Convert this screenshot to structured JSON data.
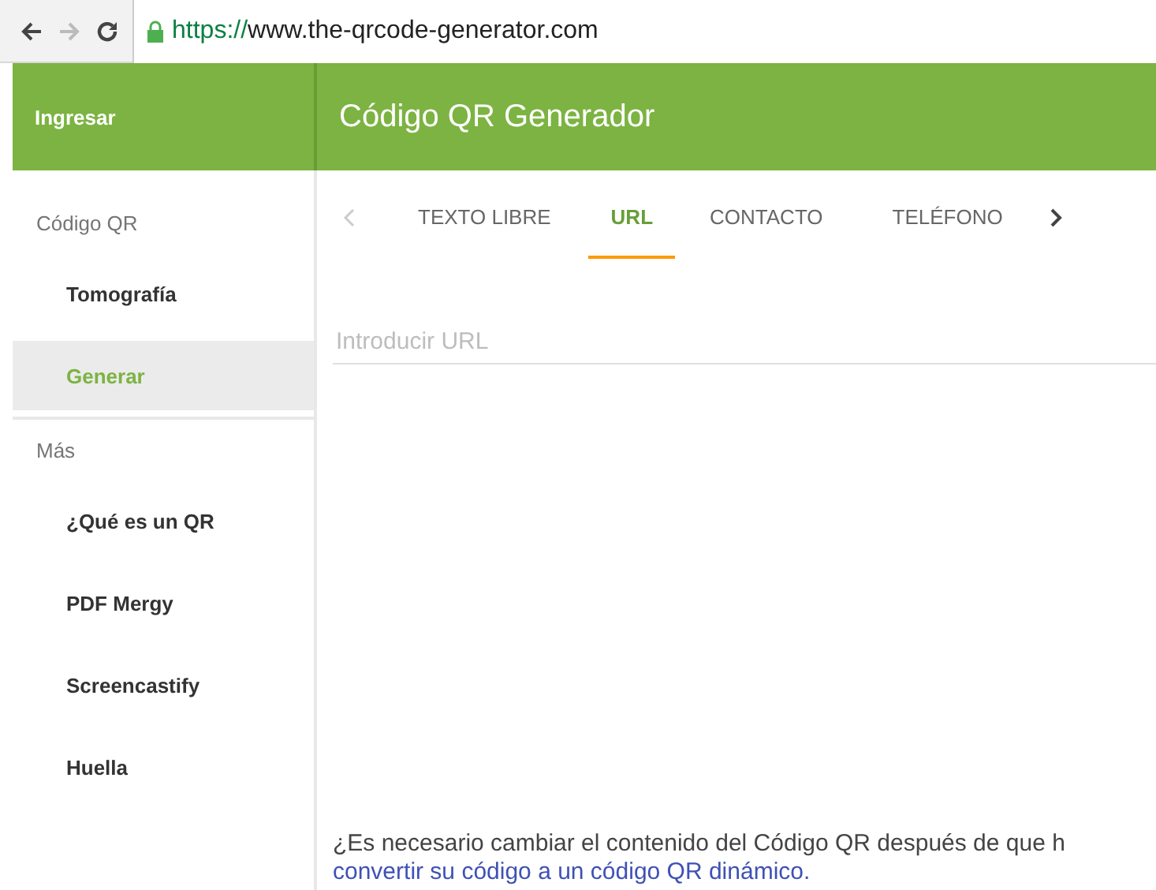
{
  "browser": {
    "url_scheme": "https://",
    "url_host": "www.the-qrcode-generator.com"
  },
  "header": {
    "login": "Ingresar",
    "title": "Código QR Generador"
  },
  "sidebar": {
    "sections": [
      {
        "heading": "Código QR",
        "items": [
          {
            "label": "Tomografía",
            "selected": false
          },
          {
            "label": "Generar",
            "selected": true
          }
        ]
      },
      {
        "heading": "Más",
        "items": [
          {
            "label": "¿Qué es un QR",
            "selected": false
          },
          {
            "label": "PDF Mergy",
            "selected": false
          },
          {
            "label": "Screencastify",
            "selected": false
          },
          {
            "label": "Huella",
            "selected": false
          }
        ]
      }
    ]
  },
  "tabs": [
    {
      "label": "TEXTO LIBRE",
      "selected": false
    },
    {
      "label": "URL",
      "selected": true
    },
    {
      "label": "CONTACTO",
      "selected": false
    },
    {
      "label": "TELÉFONO",
      "selected": false
    }
  ],
  "url_field": {
    "placeholder": "Introducir URL"
  },
  "notice": {
    "text": "¿Es necesario cambiar el contenido del Código QR después de que h",
    "link": "convertir su código a un código QR dinámico."
  }
}
